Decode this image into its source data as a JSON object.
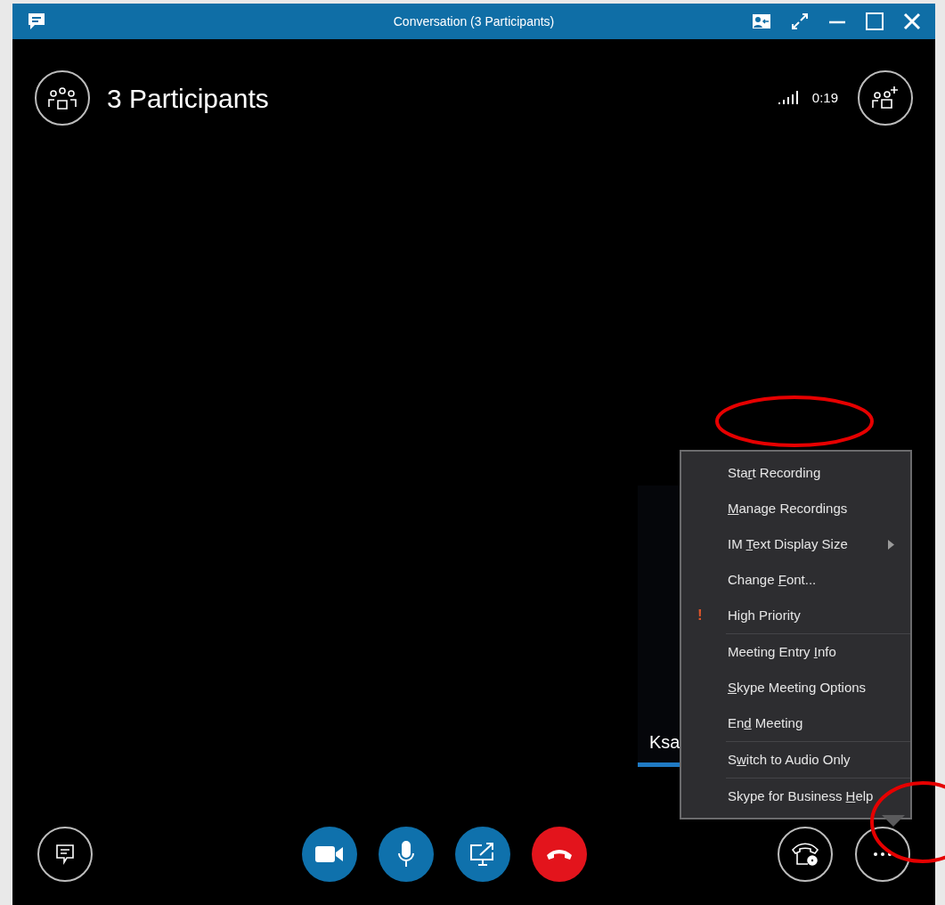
{
  "window": {
    "title": "Conversation (3 Participants)"
  },
  "header": {
    "title": "3 Participants",
    "call_time": "0:19"
  },
  "video_tile": {
    "name": "Ksa"
  },
  "menu": {
    "items": [
      {
        "kind": "plain",
        "before": "Sta",
        "key": "r",
        "after": "t Recording",
        "separator_after": false
      },
      {
        "kind": "plain",
        "key": "M",
        "after": "anage Recordings",
        "separator_after": false
      },
      {
        "kind": "submenu",
        "before": "IM ",
        "key": "T",
        "after": "ext Display Size",
        "separator_after": false
      },
      {
        "kind": "plain",
        "before": "Change ",
        "key": "F",
        "after": "ont...",
        "separator_after": false
      },
      {
        "kind": "flag",
        "mark": "!",
        "before": "High Priority",
        "separator_after": true
      },
      {
        "kind": "plain",
        "before": "Meeting Entry ",
        "key": "I",
        "after": "nfo",
        "separator_after": false
      },
      {
        "kind": "plain",
        "key": "S",
        "after": "kype Meeting Options",
        "separator_after": false
      },
      {
        "kind": "plain",
        "before": "En",
        "key": "d",
        "after": " Meeting",
        "separator_after": true
      },
      {
        "kind": "plain",
        "before": "S",
        "key": "w",
        "after": "itch to Audio Only",
        "separator_after": true
      },
      {
        "kind": "plain",
        "before": "Skype for Business ",
        "key": "H",
        "after": "elp",
        "separator_after": false
      }
    ]
  },
  "annotations": [
    {
      "kind": "ellipse",
      "color": "#e60000"
    },
    {
      "kind": "ellipse",
      "color": "#e60000"
    }
  ]
}
